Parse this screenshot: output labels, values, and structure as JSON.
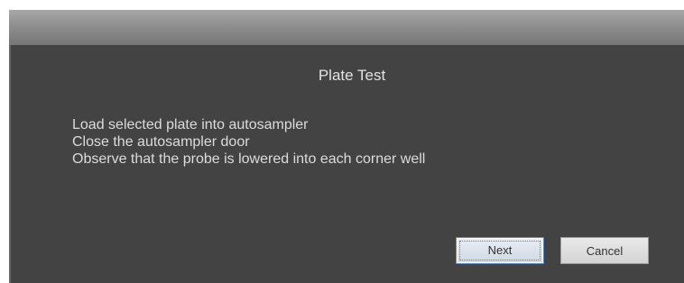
{
  "dialog": {
    "title": "Plate Test",
    "instructions": [
      "Load selected plate into autosampler",
      "Close the autosampler door",
      "Observe that the probe is lowered into each corner well"
    ],
    "buttons": {
      "next_label": "Next",
      "cancel_label": "Cancel"
    }
  }
}
